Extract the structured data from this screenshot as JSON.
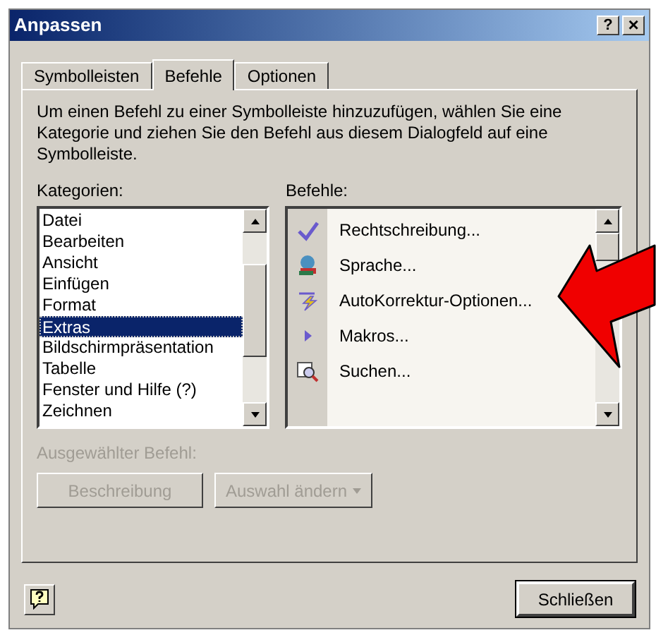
{
  "window": {
    "title": "Anpassen",
    "help_button": "?",
    "close_button": "×"
  },
  "tabs": [
    {
      "label": "Symbolleisten",
      "selected": false
    },
    {
      "label": "Befehle",
      "selected": true
    },
    {
      "label": "Optionen",
      "selected": false
    }
  ],
  "instructions": "Um einen Befehl zu einer Symbolleiste hinzuzufügen, wählen Sie eine Kategorie und ziehen Sie den Befehl aus diesem Dialogfeld auf eine Symbolleiste.",
  "categories": {
    "label": "Kategorien:",
    "items": [
      {
        "label": "Datei",
        "selected": false
      },
      {
        "label": "Bearbeiten",
        "selected": false
      },
      {
        "label": "Ansicht",
        "selected": false
      },
      {
        "label": "Einfügen",
        "selected": false
      },
      {
        "label": "Format",
        "selected": false
      },
      {
        "label": "Extras",
        "selected": true
      },
      {
        "label": "Bildschirmpräsentation",
        "selected": false
      },
      {
        "label": "Tabelle",
        "selected": false
      },
      {
        "label": "Fenster und Hilfe (?)",
        "selected": false
      },
      {
        "label": "Zeichnen",
        "selected": false
      }
    ]
  },
  "commands": {
    "label": "Befehle:",
    "items": [
      {
        "label": "Rechtschreibung...",
        "kind": "spelling"
      },
      {
        "label": "Sprache...",
        "kind": "language"
      },
      {
        "label": "AutoKorrektur-Optionen...",
        "kind": "autocorrect"
      },
      {
        "label": "Makros...",
        "kind": "macro"
      },
      {
        "label": "Suchen...",
        "kind": "find"
      }
    ]
  },
  "selected_command": {
    "label": "Ausgewählter Befehl:",
    "disabled": true
  },
  "buttons": [
    {
      "label": "Beschreibung",
      "disabled": true,
      "kind": "plain"
    },
    {
      "label": "Auswahl ändern",
      "disabled": true,
      "kind": "dropdown"
    }
  ],
  "footer": {
    "close": "Schließen"
  }
}
